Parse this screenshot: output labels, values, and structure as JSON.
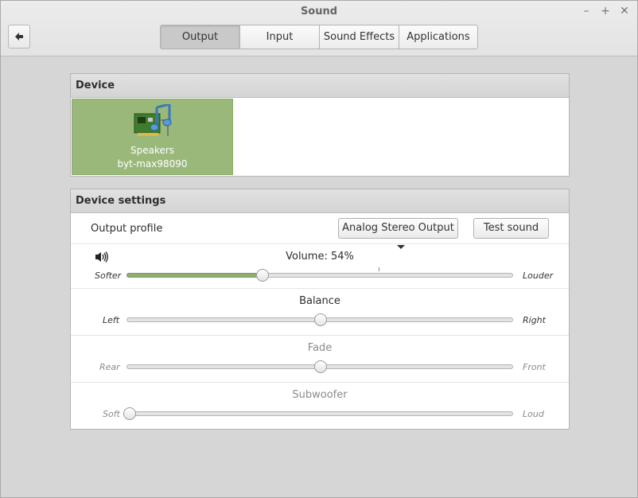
{
  "window": {
    "title": "Sound",
    "controls": [
      "–",
      "+",
      "✕"
    ]
  },
  "header": {
    "tabs": [
      {
        "label": "Output",
        "active": true
      },
      {
        "label": "Input",
        "active": false
      },
      {
        "label": "Sound Effects",
        "active": false
      },
      {
        "label": "Applications",
        "active": false
      }
    ]
  },
  "device": {
    "heading": "Device",
    "selected": {
      "name": "Speakers",
      "sub": "byt-max98090",
      "icon": "audio-card-icon"
    }
  },
  "settings": {
    "heading": "Device settings",
    "output_profile_label": "Output profile",
    "profile_value": "Analog Stereo Output",
    "test_sound_label": "Test sound",
    "volume": {
      "title": "Volume: 54%",
      "left": "Softer",
      "right": "Louder",
      "value": 0.35
    },
    "balance": {
      "title": "Balance",
      "left": "Left",
      "right": "Right",
      "value": 0.5
    },
    "fade": {
      "title": "Fade",
      "left": "Rear",
      "right": "Front",
      "value": 0.5
    },
    "subwoofer": {
      "title": "Subwoofer",
      "left": "Soft",
      "right": "Loud",
      "value": 0.0
    }
  },
  "colors": {
    "accent": "#9ab87a",
    "fill": "#8fad70"
  }
}
